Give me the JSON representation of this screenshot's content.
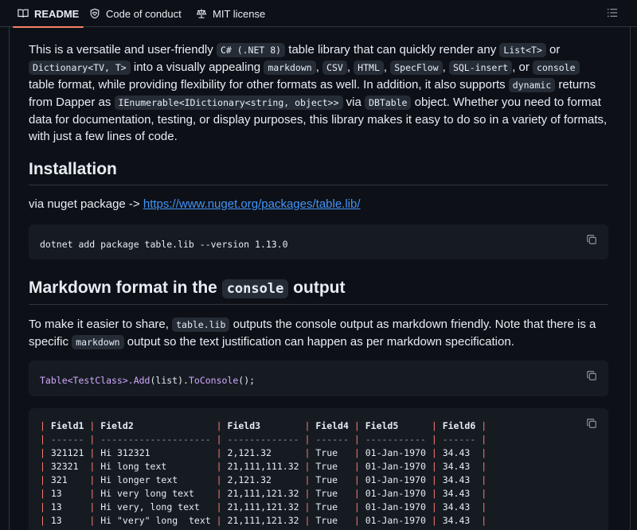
{
  "tabs": [
    {
      "label": "README",
      "icon": "book-icon",
      "active": true
    },
    {
      "label": "Code of conduct",
      "icon": "heart-shield-icon",
      "active": false
    },
    {
      "label": "MIT license",
      "icon": "scale-icon",
      "active": false
    }
  ],
  "intro": {
    "t1": "This is a versatile and user-friendly ",
    "c1": "C# (.NET 8)",
    "t2": " table library that can quickly render any ",
    "c2": "List<T>",
    "t3": " or ",
    "c3": "Dictionary<TV, T>",
    "t4": " into a visually appealing ",
    "c4": "markdown",
    "t5": ", ",
    "c5": "CSV",
    "t6": ", ",
    "c6": "HTML",
    "t7": ", ",
    "c7": "SpecFlow",
    "t8": ", ",
    "c8": "SQL-insert",
    "t9": ", or ",
    "c9": "console",
    "t10": " table format, while providing flexibility for other formats as well. In addition, it also supports ",
    "c10": "dynamic",
    "t11": " returns from Dapper as ",
    "c11": "IEnumerable<IDictionary<string, object>>",
    "t12": " via ",
    "c12": "DBTable",
    "t13": " object. Whether you need to format data for documentation, testing, or display purposes, this library makes it easy to do so in a variety of formats, with just a few lines of code."
  },
  "installation": {
    "heading": "Installation",
    "via_text": "via nuget package -> ",
    "link": "https://www.nuget.org/packages/table.lib/",
    "command": "dotnet add package table.lib --version 1.13.0"
  },
  "markdown_section": {
    "heading_pre": "Markdown format in the ",
    "heading_code": "console",
    "heading_post": " output",
    "p_t1": "To make it easier to share, ",
    "p_c1": "table.lib",
    "p_t2": " outputs the console output as markdown friendly. Note that there is a specific ",
    "p_c2": "markdown",
    "p_t3": " output so the text justification can happen as per markdown specification.",
    "code_cls": "Table<TestClass>",
    "code_add": ".Add",
    "code_list": "(list)",
    "code_dot": ".",
    "code_fn": "ToConsole",
    "code_end": "();"
  },
  "table_output": {
    "headers": [
      "Field1",
      "Field2",
      "Field3",
      "Field4",
      "Field5",
      "Field6"
    ],
    "separators": [
      "------",
      "--------------------",
      "-------------",
      "------",
      "-----------",
      "------"
    ],
    "rows": [
      [
        "321121",
        "Hi 312321",
        "2,121.32",
        "True",
        "01-Jan-1970",
        "34.43"
      ],
      [
        "32321",
        "Hi long text",
        "21,111,111.32",
        "True",
        "01-Jan-1970",
        "34.43"
      ],
      [
        "321",
        "Hi longer text",
        "2,121.32",
        "True",
        "01-Jan-1970",
        "34.43"
      ],
      [
        "13",
        "Hi very long text",
        "21,111,121.32",
        "True",
        "01-Jan-1970",
        "34.43"
      ],
      [
        "13",
        "Hi very, long text",
        "21,111,121.32",
        "True",
        "01-Jan-1970",
        "34.43"
      ],
      [
        "13",
        "Hi \"very\" long  text",
        "21,111,121.32",
        "True",
        "01-Jan-1970",
        "34.43"
      ]
    ]
  },
  "colors": {
    "accent": "#f78166",
    "link": "#4493f8",
    "pipe": "#ff7b72",
    "bg": "#0d1117",
    "code_bg": "#161b22"
  }
}
